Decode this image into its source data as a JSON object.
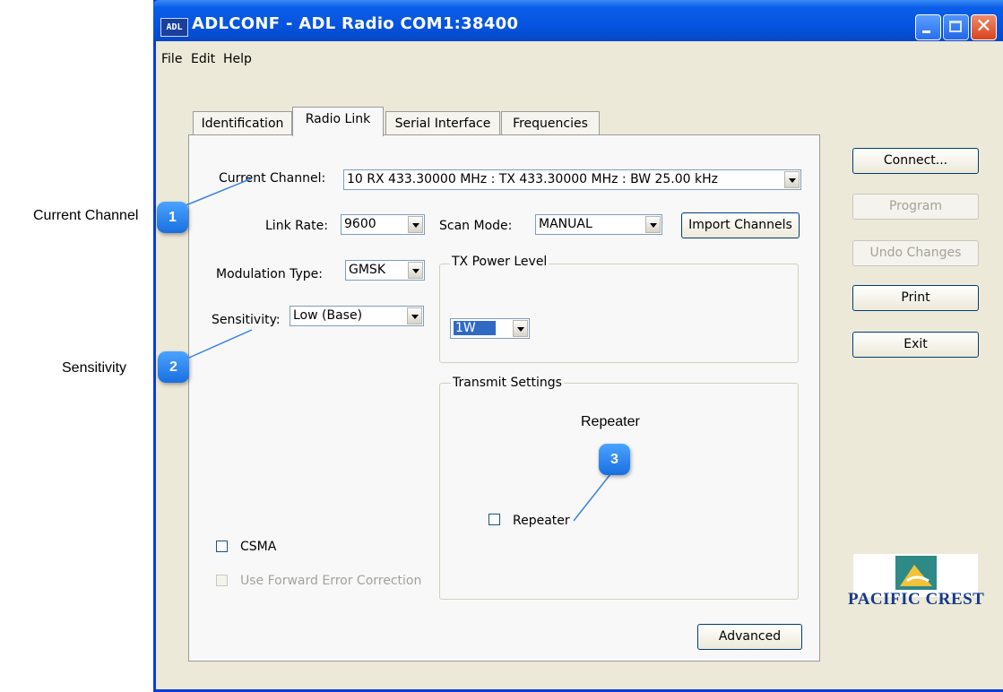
{
  "window": {
    "icon_text": "ADL",
    "title": "ADLCONF - ADL Radio COM1:38400"
  },
  "menu": [
    "File",
    "Edit",
    "Help"
  ],
  "tabs": [
    "Identification",
    "Radio Link",
    "Serial Interface",
    "Frequencies"
  ],
  "radio_link": {
    "current_channel_label": "Current Channel:",
    "current_channel_value": "10 RX 433.30000 MHz : TX 433.30000 MHz : BW 25.00 kHz",
    "link_rate_label": "Link Rate:",
    "link_rate_value": "9600",
    "scan_mode_label": "Scan Mode:",
    "scan_mode_value": "MANUAL",
    "import_channels_label": "Import Channels",
    "modulation_label": "Modulation Type:",
    "modulation_value": "GMSK",
    "sensitivity_label": "Sensitivity:",
    "sensitivity_value": "Low (Base)",
    "tx_power_title": "TX Power Level",
    "tx_power_value": "1W",
    "transmit_settings_title": "Transmit Settings",
    "repeater_checkbox_label": "Repeater",
    "repeater_checked": false,
    "csma_label": "CSMA",
    "csma_checked": false,
    "fec_label": "Use Forward Error Correction",
    "fec_checked": false,
    "advanced_label": "Advanced"
  },
  "side_buttons": {
    "connect": "Connect...",
    "program": "Program",
    "undo": "Undo Changes",
    "print": "Print",
    "exit": "Exit"
  },
  "logo_text": "PACIFIC CREST",
  "callouts": [
    {
      "number": "1",
      "label": "Current Channel"
    },
    {
      "number": "2",
      "label": "Sensitivity"
    },
    {
      "number": "3",
      "label": "Repeater"
    }
  ],
  "colors": {
    "titlebar": "#0654e0",
    "client_bg": "#ece9d8",
    "selection": "#316ac5",
    "badge": "#1a6fe0"
  }
}
